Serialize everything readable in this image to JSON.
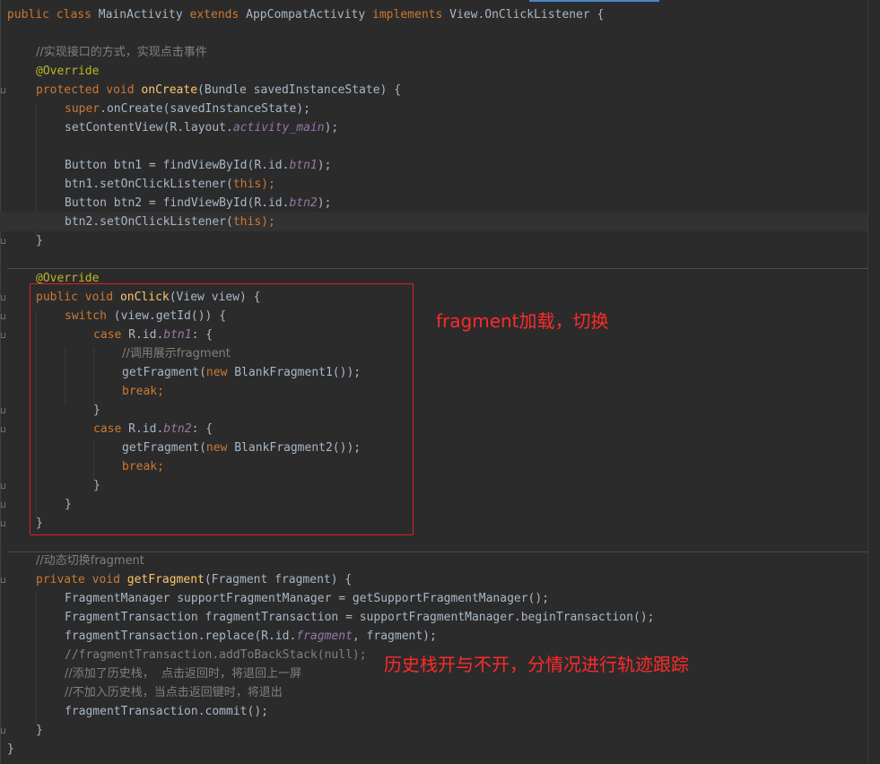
{
  "lines": {
    "l1": {
      "kw_public": "public",
      "kw_class": "class",
      "class_name": "MainActivity",
      "kw_extends": "extends",
      "super_class": "AppCompatActivity",
      "kw_implements": "implements",
      "iface": "View.OnClickListener",
      "brace": "{"
    },
    "l3": {
      "comment": "//实现接口的方式，实现点击事件"
    },
    "l4": {
      "annotation": "@Override"
    },
    "l5": {
      "kw_protected": "protected",
      "kw_void": "void",
      "method": "onCreate",
      "params": "(Bundle savedInstanceState) {"
    },
    "l6": {
      "kw_super": "super",
      "rest": ".onCreate(savedInstanceState);"
    },
    "l7": {
      "call": "setContentView(R.layout.",
      "field": "activity_main",
      "close": ");"
    },
    "l9": {
      "decl": "Button btn1 = findViewById(R.id.",
      "field": "btn1",
      "close": ");"
    },
    "l10": {
      "call": "btn1.setOnClickListener(",
      "kw_this": "this",
      "close": ");"
    },
    "l11": {
      "decl": "Button btn2 = findViewById(R.id.",
      "field": "btn2",
      "close": ");"
    },
    "l12": {
      "call": "btn2.setOnClickListener(",
      "kw_this": "this",
      "close": ");"
    },
    "l13": {
      "brace": "}"
    },
    "l15": {
      "annotation": "@Override"
    },
    "l16": {
      "kw_public": "public",
      "kw_void": "void",
      "method": "onClick",
      "params": "(View view) {"
    },
    "l17": {
      "kw_switch": "switch",
      "rest": " (view.getId()) {"
    },
    "l18": {
      "kw_case": "case",
      "ref": " R.id.",
      "field": "btn1",
      "rest": ": {"
    },
    "l19": {
      "comment": "//调用展示fragment"
    },
    "l20": {
      "call": "getFragment(",
      "kw_new": "new",
      "rest": " BlankFragment1());"
    },
    "l21": {
      "kw_break": "break",
      "semi": ";"
    },
    "l22": {
      "brace": "}"
    },
    "l23": {
      "kw_case": "case",
      "ref": " R.id.",
      "field": "btn2",
      "rest": ": {"
    },
    "l24": {
      "call": "getFragment(",
      "kw_new": "new",
      "rest": " BlankFragment2());"
    },
    "l25": {
      "kw_break": "break",
      "semi": ";"
    },
    "l26": {
      "brace": "}"
    },
    "l27": {
      "brace": "}"
    },
    "l28": {
      "brace": "}"
    },
    "l30": {
      "comment": "//动态切换fragment"
    },
    "l31": {
      "kw_private": "private",
      "kw_void": "void",
      "method": "getFragment",
      "params": "(Fragment fragment) {"
    },
    "l32": {
      "code": "FragmentManager supportFragmentManager = getSupportFragmentManager();"
    },
    "l33": {
      "code": "FragmentTransaction fragmentTransaction = supportFragmentManager.beginTransaction();"
    },
    "l34": {
      "call": "fragmentTransaction.replace(R.id.",
      "field": "fragment",
      "rest": ", fragment);"
    },
    "l35": {
      "comment": "//fragmentTransaction.addToBackStack(null);"
    },
    "l36": {
      "comment": "//添加了历史栈，  点击返回时，将退回上一屏"
    },
    "l37": {
      "comment": "//不加入历史栈，当点击返回键时，将退出"
    },
    "l38": {
      "code": "fragmentTransaction.commit();"
    },
    "l39": {
      "brace": "}"
    },
    "l40": {
      "brace": "}"
    }
  },
  "annotations": {
    "note1": "fragment加载，切换",
    "note2": "历史栈开与不开，分情况进行轨迹跟踪"
  },
  "colors": {
    "background": "#2b2b2b",
    "keyword": "#cc7832",
    "method": "#ffc66d",
    "annotation": "#bbb529",
    "field": "#9876aa",
    "comment": "#808080",
    "text": "#a9b7c6",
    "highlight_box": "#e02020",
    "note_text": "#ff2a2a"
  }
}
